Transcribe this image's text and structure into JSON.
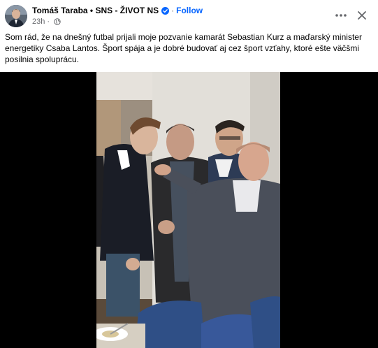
{
  "post": {
    "author": "Tomáš Taraba • SNS - ŽIVOT NS",
    "separator": "·",
    "follow_label": "Follow",
    "time": "23h",
    "time_separator": "·",
    "text": "Som rád, že na dnešný futbal prijali moje pozvanie kamarát Sebastian Kurz a maďarský minister energetiky Csaba Lantos. Šport spája a je dobré budovať aj cez šport vzťahy, ktoré ešte väčšmi posilnia spoluprácu."
  },
  "icons": {
    "verified": "verified-badge-icon",
    "audience": "globe-icon",
    "more": "more-options-icon",
    "close": "close-icon"
  },
  "colors": {
    "accent": "#0866ff",
    "text": "#050505",
    "secondary_text": "#65676b",
    "media_background": "#000000"
  }
}
